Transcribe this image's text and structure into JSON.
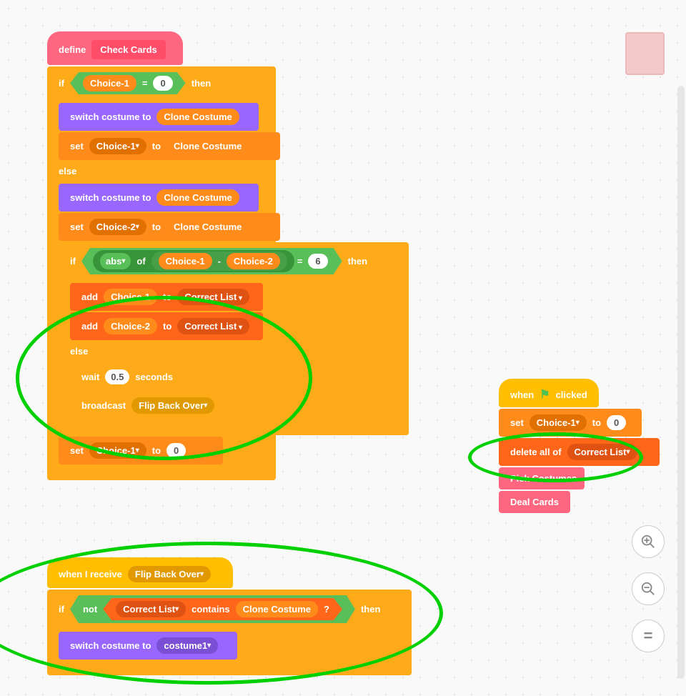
{
  "define": {
    "keyword": "define",
    "proc_name": "Check Cards"
  },
  "if1": {
    "kw_if": "if",
    "kw_then": "then",
    "kw_else": "else",
    "choice1": "Choice-1",
    "eq": "=",
    "zero": "0"
  },
  "switch1": {
    "label": "switch costume to",
    "value": "Clone Costume"
  },
  "set1": {
    "label_set": "set",
    "var": "Choice-1",
    "label_to": "to",
    "value": "Clone Costume"
  },
  "switch2": {
    "label": "switch costume to",
    "value": "Clone Costume"
  },
  "set2": {
    "label_set": "set",
    "var": "Choice-2",
    "label_to": "to",
    "value": "Clone Costume"
  },
  "if2": {
    "kw_if": "if",
    "kw_then": "then",
    "kw_else": "else",
    "abs": "abs",
    "of": "of",
    "c1": "Choice-1",
    "minus": "-",
    "c2": "Choice-2",
    "eq": "=",
    "six": "6"
  },
  "add1": {
    "kw_add": "add",
    "var": "Choice-1",
    "kw_to": "to",
    "list": "Correct List"
  },
  "add2": {
    "kw_add": "add",
    "var": "Choice-2",
    "kw_to": "to",
    "list": "Correct List"
  },
  "wait": {
    "kw_wait": "wait",
    "secs": "0.5",
    "kw_seconds": "seconds"
  },
  "broadcast": {
    "kw": "broadcast",
    "msg": "Flip Back Over"
  },
  "set3": {
    "label_set": "set",
    "var": "Choice-1",
    "label_to": "to",
    "value": "0"
  },
  "hat2": {
    "kw_when_receive": "when I receive",
    "msg": "Flip Back Over"
  },
  "if3": {
    "kw_if": "if",
    "kw_then": "then",
    "not": "not",
    "list": "Correct List",
    "contains": "contains",
    "val": "Clone Costume",
    "q": "?"
  },
  "switch3": {
    "label": "switch costume to",
    "value": "costume1"
  },
  "hat3": {
    "kw_when": "when",
    "kw_clicked": "clicked"
  },
  "set4": {
    "label_set": "set",
    "var": "Choice-1",
    "label_to": "to",
    "value": "0"
  },
  "delall": {
    "kw": "delete all of",
    "list": "Correct List"
  },
  "proc_pick": "Pick Costumes",
  "proc_deal": "Deal Cards",
  "zoom": {
    "eq": "="
  }
}
